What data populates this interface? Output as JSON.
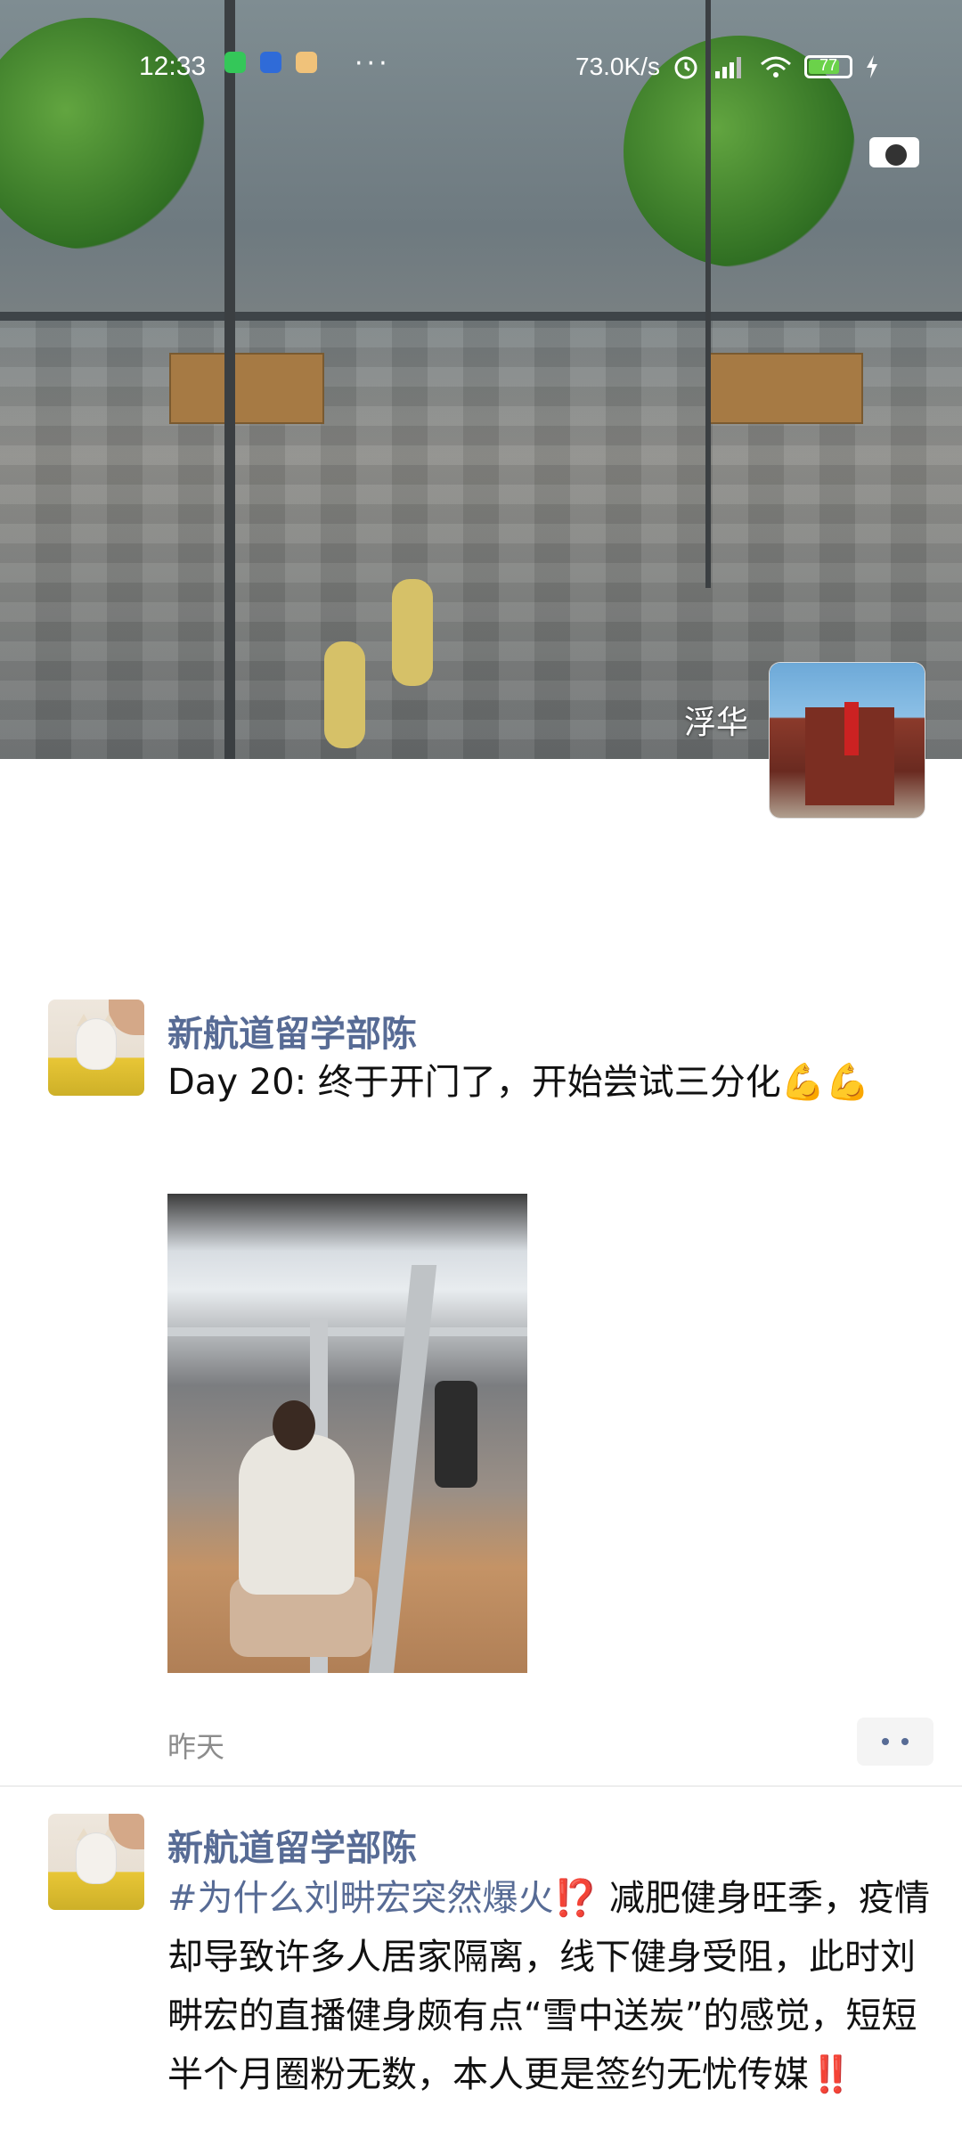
{
  "status_bar": {
    "time": "12:33",
    "left_icons": [
      "app-icon-green",
      "app-icon-blue",
      "app-icon-pizza"
    ],
    "more": "···",
    "network_speed": "73.0K/s",
    "battery": "77",
    "battery_fraction": 0.77
  },
  "cover": {
    "name": "浮华"
  },
  "posts": [
    {
      "author": "新航道留学部陈",
      "text": "Day 20: 终于开门了，开始尝试三分化💪💪",
      "time": "昨天"
    },
    {
      "author": "新航道留学部陈",
      "tag": "#为什么刘畊宏突然爆火⁉️",
      "text": " 减肥健身旺季，疫情却导致许多人居家隔离，线下健身受阻，此时刘畊宏的直播健身颇有点“雪中送炭”的感觉，短短半个月圈粉无数，本人更是签约无忧传媒‼️"
    }
  ],
  "colors": {
    "link": "#576b95",
    "time_text": "#8c8c8c",
    "divider": "#ededed"
  }
}
